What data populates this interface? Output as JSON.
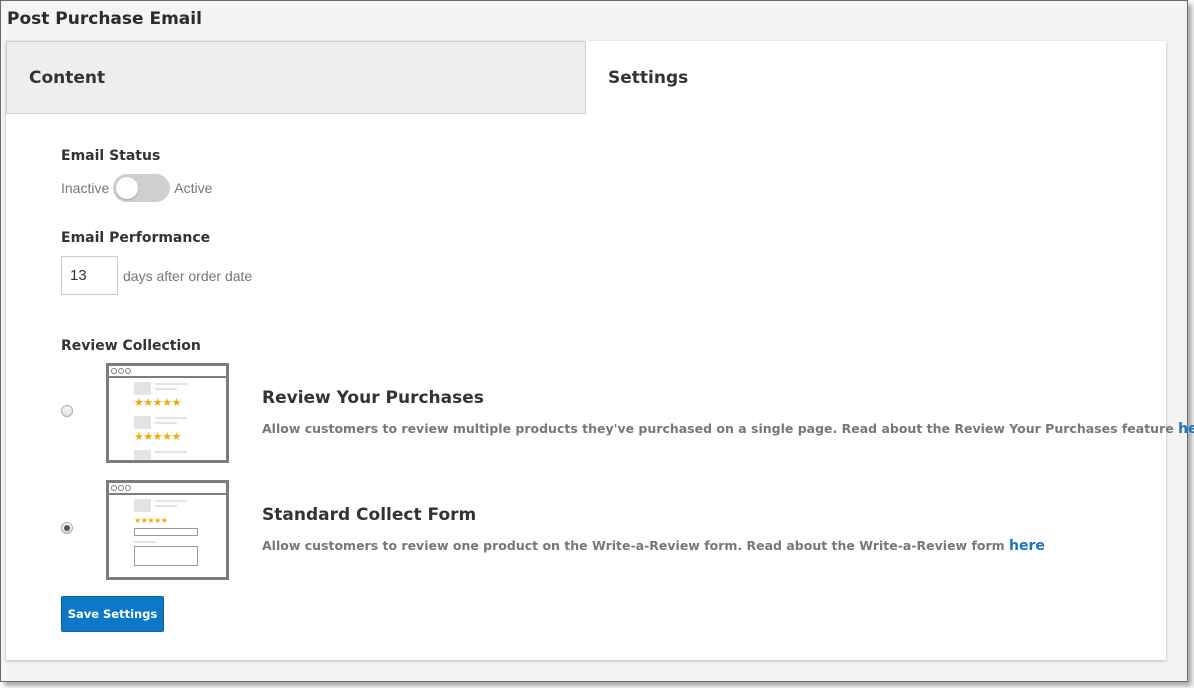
{
  "page": {
    "title": "Post Purchase Email"
  },
  "tabs": [
    {
      "label": "Content",
      "active": false
    },
    {
      "label": "Settings",
      "active": true
    }
  ],
  "email_status": {
    "label": "Email Status",
    "off_label": "Inactive",
    "on_label": "Active",
    "enabled": false
  },
  "email_performance": {
    "label": "Email Performance",
    "days_value": "13",
    "suffix": "days after order date"
  },
  "review_collection": {
    "label": "Review Collection",
    "options": [
      {
        "title": "Review Your Purchases",
        "description": "Allow customers to review multiple products they've purchased on a single page. Read about the Review Your Purchases feature",
        "link_text": "here",
        "selected": false
      },
      {
        "title": "Standard Collect Form",
        "description": "Allow customers to review one product on the Write-a-Review form. Read about the Write-a-Review form",
        "link_text": "here",
        "selected": true
      }
    ],
    "thumbnail_stars": "★★★★★"
  },
  "actions": {
    "save_label": "Save Settings"
  },
  "colors": {
    "primary_button": "#0d78c5",
    "link": "#1b73c4",
    "star": "#f2a900",
    "toggle_off": "#cfcfcf"
  }
}
